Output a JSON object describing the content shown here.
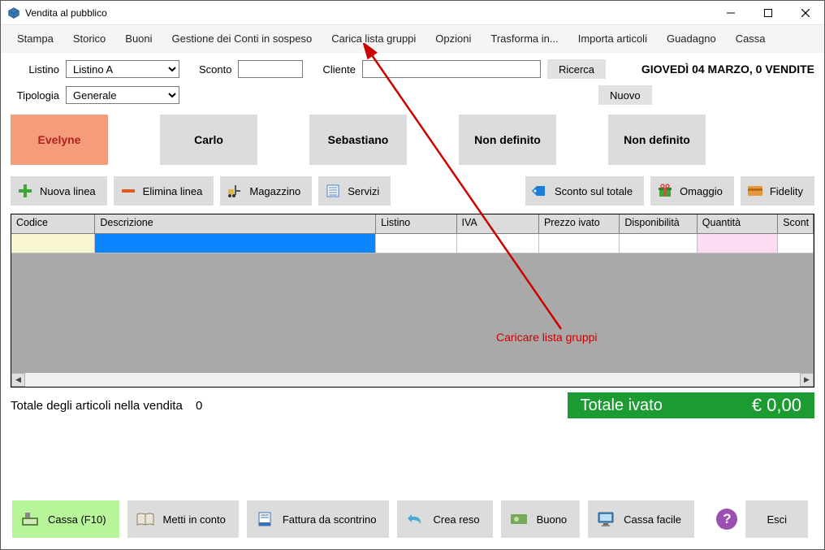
{
  "window": {
    "title": "Vendita al pubblico"
  },
  "menu": {
    "items": [
      "Stampa",
      "Storico",
      "Buoni",
      "Gestione dei Conti in sospeso",
      "Carica lista gruppi",
      "Opzioni",
      "Trasforma in...",
      "Importa articoli",
      "Guadagno",
      "Cassa"
    ]
  },
  "filters": {
    "listino_label": "Listino",
    "listino_value": "Listino A",
    "sconto_label": "Sconto",
    "sconto_value": "",
    "cliente_label": "Cliente",
    "cliente_value": "",
    "ricerca": "Ricerca",
    "nuovo": "Nuovo",
    "tipologia_label": "Tipologia",
    "tipologia_value": "Generale",
    "date_status": "GIOVEDÌ 04 MARZO, 0 VENDITE"
  },
  "profiles": {
    "items": [
      "Evelyne",
      "Carlo",
      "Sebastiano",
      "Non definito",
      "Non definito"
    ]
  },
  "toolbar": {
    "nuova_linea": "Nuova linea",
    "elimina_linea": "Elimina linea",
    "magazzino": "Magazzino",
    "servizi": "Servizi",
    "sconto_totale": "Sconto sul totale",
    "omaggio": "Omaggio",
    "fidelity": "Fidelity"
  },
  "grid": {
    "headers": {
      "codice": "Codice",
      "desc": "Descrizione",
      "listino": "Listino",
      "iva": "IVA",
      "prezzo": "Prezzo ivato",
      "disp": "Disponibilità",
      "qta": "Quantità",
      "sconto": "Scont"
    },
    "row": {
      "codice": "",
      "desc": "",
      "listino": "",
      "iva": "",
      "prezzo": "",
      "disp": "",
      "qta": "",
      "sconto": ""
    }
  },
  "totals": {
    "left_label": "Totale degli articoli nella vendita",
    "count": "0",
    "right_label": "Totale ivato",
    "right_value": "€ 0,00"
  },
  "bottom": {
    "cassa": "Cassa (F10)",
    "metti": "Metti in conto",
    "fattura": "Fattura da scontrino",
    "reso": "Crea reso",
    "buono": "Buono",
    "facile": "Cassa facile",
    "esci": "Esci"
  },
  "annotation": {
    "text": "Caricare lista gruppi"
  }
}
